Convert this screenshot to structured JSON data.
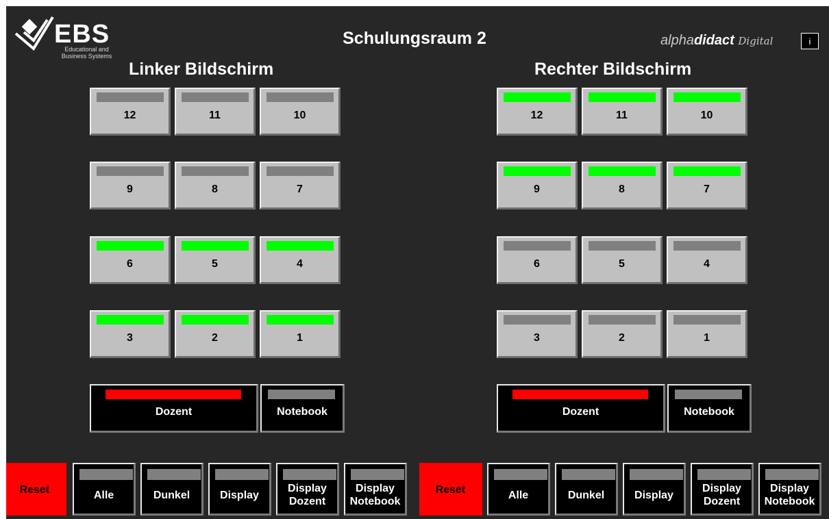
{
  "header": {
    "logo_text": "EBS",
    "logo_sub": "Educational and Business Systems",
    "title": "Schulungsraum 2",
    "brand_alpha": "alpha",
    "brand_didact": "didact",
    "brand_digital": "Digital",
    "info_label": "i"
  },
  "left": {
    "heading": "Linker Bildschirm",
    "rows": [
      [
        {
          "label": "12",
          "active": false
        },
        {
          "label": "11",
          "active": false
        },
        {
          "label": "10",
          "active": false
        }
      ],
      [
        {
          "label": "9",
          "active": false
        },
        {
          "label": "8",
          "active": false
        },
        {
          "label": "7",
          "active": false
        }
      ],
      [
        {
          "label": "6",
          "active": true
        },
        {
          "label": "5",
          "active": true
        },
        {
          "label": "4",
          "active": true
        }
      ],
      [
        {
          "label": "3",
          "active": true
        },
        {
          "label": "2",
          "active": true
        },
        {
          "label": "1",
          "active": true
        }
      ]
    ],
    "dozent": "Dozent",
    "notebook": "Notebook"
  },
  "right": {
    "heading": "Rechter Bildschirm",
    "rows": [
      [
        {
          "label": "12",
          "active": true
        },
        {
          "label": "11",
          "active": true
        },
        {
          "label": "10",
          "active": true
        }
      ],
      [
        {
          "label": "9",
          "active": true
        },
        {
          "label": "8",
          "active": true
        },
        {
          "label": "7",
          "active": true
        }
      ],
      [
        {
          "label": "6",
          "active": false
        },
        {
          "label": "5",
          "active": false
        },
        {
          "label": "4",
          "active": false
        }
      ],
      [
        {
          "label": "3",
          "active": false
        },
        {
          "label": "2",
          "active": false
        },
        {
          "label": "1",
          "active": false
        }
      ]
    ],
    "dozent": "Dozent",
    "notebook": "Notebook"
  },
  "bottom": {
    "left": [
      "Reset",
      "Alle",
      "Dunkel",
      "Display",
      "Display Dozent",
      "Display Notebook"
    ],
    "right": [
      "Reset",
      "Alle",
      "Dunkel",
      "Display",
      "Display Dozent",
      "Display Notebook"
    ]
  },
  "colors": {
    "active": "#00ff00",
    "inactive": "#808080",
    "dozent_bar": "#ff0000",
    "reset": "#ff0000",
    "background": "#272727"
  }
}
